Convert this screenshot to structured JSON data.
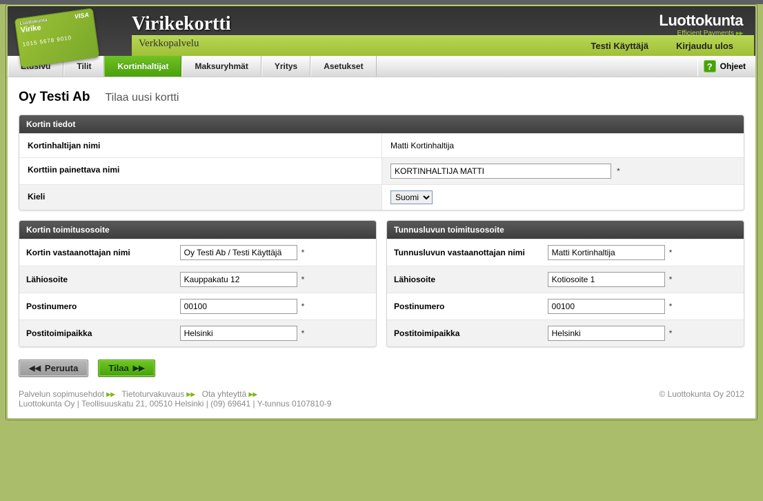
{
  "brand": {
    "title": "Virikekortti",
    "subtitle": "Verkkopalvelu",
    "card_label": "Virike",
    "card_brand": "Luottokunta",
    "card_network": "VISA",
    "card_number": "1015 5678 9010",
    "logo_line1": "Luottokunta",
    "logo_line2": "Efficient Payments"
  },
  "header": {
    "user": "Testi Käyttäjä",
    "logout": "Kirjaudu ulos"
  },
  "nav": {
    "items": [
      "Etusivu",
      "Tilit",
      "Kortinhaltijat",
      "Maksuryhmät",
      "Yritys",
      "Asetukset"
    ],
    "help": "Ohjeet",
    "active_index": 2
  },
  "page": {
    "company": "Oy Testi Ab",
    "action": "Tilaa uusi kortti"
  },
  "card_info": {
    "title": "Kortin tiedot",
    "holder_label": "Kortinhaltijan nimi",
    "holder_value": "Matti Kortinhaltija",
    "printed_label": "Korttiin painettava nimi",
    "printed_value": "KORTINHALTIJA MATTI",
    "lang_label": "Kieli",
    "lang_value": "Suomi"
  },
  "ship_card": {
    "title": "Kortin toimitusosoite",
    "recipient_label": "Kortin vastaanottajan nimi",
    "recipient_value": "Oy Testi Ab / Testi Käyttäjä",
    "street_label": "Lähiosoite",
    "street_value": "Kauppakatu 12",
    "zip_label": "Postinumero",
    "zip_value": "00100",
    "city_label": "Postitoimipaikka",
    "city_value": "Helsinki"
  },
  "ship_pin": {
    "title": "Tunnusluvun toimitusosoite",
    "recipient_label": "Tunnusluvun vastaanottajan nimi",
    "recipient_value": "Matti Kortinhaltija",
    "street_label": "Lähiosoite",
    "street_value": "Kotiosoite 1",
    "zip_label": "Postinumero",
    "zip_value": "00100",
    "city_label": "Postitoimipaikka",
    "city_value": "Helsinki"
  },
  "buttons": {
    "cancel": "Peruuta",
    "order": "Tilaa"
  },
  "footer": {
    "link1": "Palvelun sopimusehdot",
    "link2": "Tietoturvakuvaus",
    "link3": "Ota yhteyttä",
    "line2": "Luottokunta Oy | Teollisuuskatu 21, 00510 Helsinki | (09) 69641 | Y-tunnus 0107810-9",
    "copyright": "© Luottokunta Oy 2012"
  },
  "symbols": {
    "req": "*"
  }
}
